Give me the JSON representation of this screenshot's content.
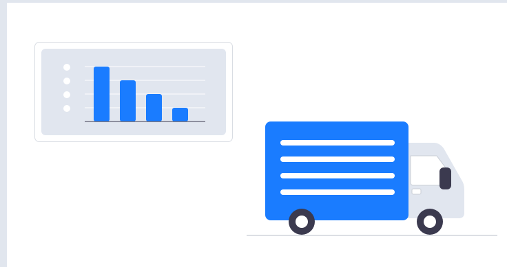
{
  "colors": {
    "background": "#e1e6ee",
    "canvas": "#ffffff",
    "accent_blue": "#1a7cff",
    "panel_gray": "#e1e6ef",
    "dark": "#3b3a4f",
    "ground": "#c8ccd3"
  },
  "chart_card": {
    "icon": "bar-chart-illustration",
    "chart_data": {
      "type": "bar",
      "categories": [
        "",
        "",
        "",
        ""
      ],
      "values": [
        4,
        3,
        2,
        1
      ],
      "ylim": [
        0,
        4
      ],
      "grid": true,
      "legend_markers": 4
    }
  },
  "truck": {
    "icon": "delivery-truck-illustration",
    "cargo_lines": 4,
    "wheels": 2
  }
}
